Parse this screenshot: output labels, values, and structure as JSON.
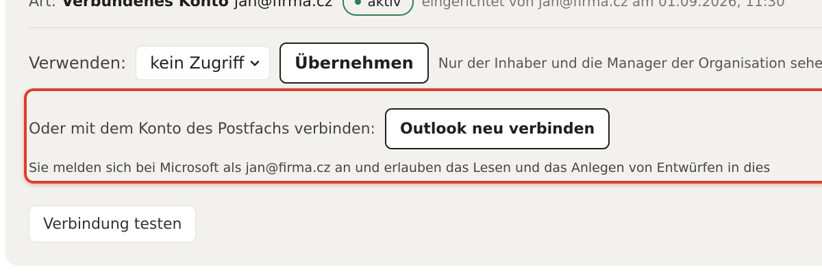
{
  "account": {
    "label": "Art:",
    "type": "Verbundenes Konto",
    "email": "jan@firma.cz",
    "status": "aktiv",
    "status_color": "#2e7d55",
    "meta": "eingerichtet von jan@firma.cz am 01.09.2026, 11:30"
  },
  "usage": {
    "label": "Verwenden:",
    "selected": "kein Zugriff",
    "apply_label": "Übernehmen",
    "note": "Nur der Inhaber und die Manager der Organisation sehen"
  },
  "connect": {
    "label": "Oder mit dem Konto des Postfachs verbinden:",
    "button_label": "Outlook neu verbinden",
    "info": "Sie melden sich bei Microsoft als jan@firma.cz an und erlauben das Lesen und das Anlegen von Entwürfen in dies"
  },
  "test": {
    "button_label": "Verbindung testen"
  },
  "colors": {
    "highlight": "#d8412b",
    "card_bg": "#f2f1ee"
  }
}
